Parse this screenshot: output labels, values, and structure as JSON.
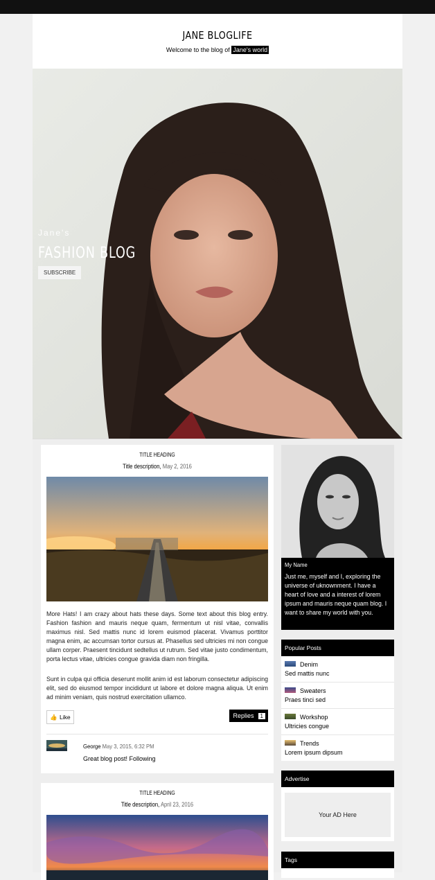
{
  "header": {
    "title": "JANE BLOGLIFE",
    "tagline_prefix": "Welcome to the blog of",
    "tagline_highlight": "Jane's world"
  },
  "hero": {
    "subtitle": "Jane's",
    "title": "FASHION BLOG",
    "button_label": "SUBSCRIBE"
  },
  "posts": [
    {
      "title": "TITLE HEADING",
      "description_label": "Title description,",
      "date": "May 2, 2016",
      "paragraphs": [
        "More Hats! I am crazy about hats these days. Some text about this blog entry. Fashion fashion and mauris neque quam, fermentum ut nisl vitae, convallis maximus nisl. Sed mattis nunc id lorem euismod placerat. Vivamus porttitor magna enim, ac accumsan tortor cursus at. Phasellus sed ultricies mi non congue ullam corper. Praesent tincidunt sedtellus ut rutrum. Sed vitae justo condimentum, porta lectus vitae, ultricies congue gravida diam non fringilla.",
        "Sunt in culpa qui officia deserunt mollit anim id est laborum consectetur adipiscing elit, sed do eiusmod tempor incididunt ut labore et dolore magna aliqua. Ut enim ad minim veniam, quis nostrud exercitation ullamco."
      ],
      "like_label": "Like",
      "replies_label": "Replies",
      "replies_count": "1",
      "comment": {
        "author": "George",
        "date": "May 3, 2015, 6:32 PM",
        "text": "Great blog post! Following"
      }
    },
    {
      "title": "TITLE HEADING",
      "description_label": "Title description,",
      "date": "April 23, 2016"
    }
  ],
  "sidebar": {
    "profile": {
      "name": "My Name",
      "bio": "Just me, myself and I, exploring the universe of uknownment. I have a heart of love and a interest of lorem ipsum and mauris neque quam blog. I want to share my world with you."
    },
    "popular": {
      "heading": "Popular Posts",
      "items": [
        {
          "label": "Denim",
          "desc": "Sed mattis nunc"
        },
        {
          "label": "Sweaters",
          "desc": "Praes tinci sed"
        },
        {
          "label": "Workshop",
          "desc": "Ultricies congue"
        },
        {
          "label": "Trends",
          "desc": "Lorem ipsum dipsum"
        }
      ]
    },
    "advertise": {
      "heading": "Advertise",
      "ad_text": "Your AD Here"
    },
    "tags": {
      "heading": "Tags"
    }
  }
}
